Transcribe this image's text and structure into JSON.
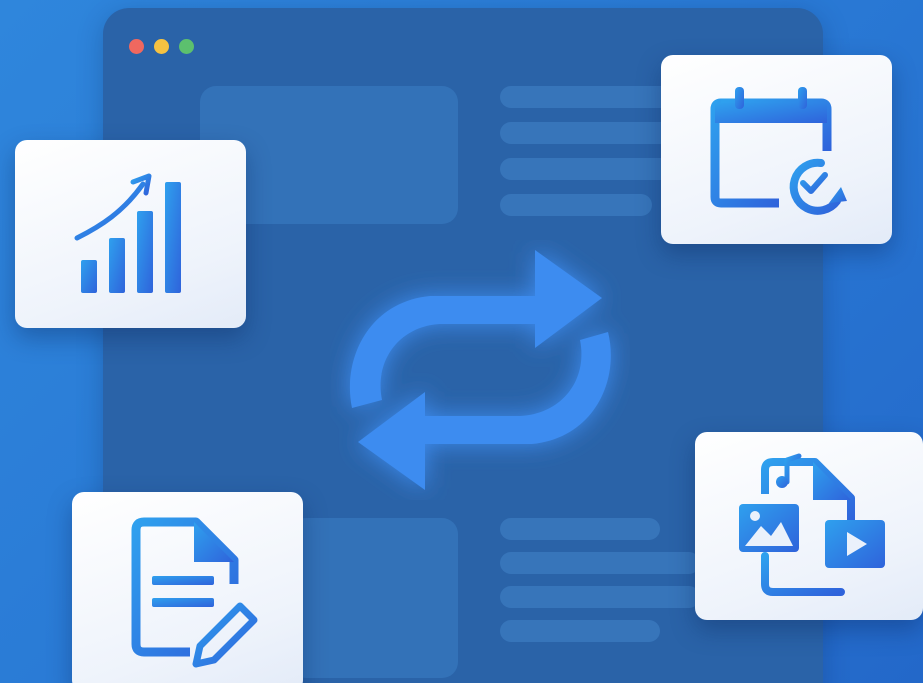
{
  "window": {
    "dots": {
      "red": "#f0685f",
      "yellow": "#f5c242",
      "green": "#5cc06e"
    }
  },
  "colors": {
    "background": "#2a7bd6",
    "window": "#2a63a8",
    "placeholder": "#3473b8",
    "accent": "#3d8cf0",
    "icon_gradient_start": "#2fa0ee",
    "icon_gradient_end": "#2f63db"
  },
  "icons": {
    "center": "sync-icon",
    "top_left_card": "growth-chart-icon",
    "top_right_card": "calendar-schedule-icon",
    "bottom_left_card": "document-edit-icon",
    "bottom_right_card": "media-files-icon"
  }
}
